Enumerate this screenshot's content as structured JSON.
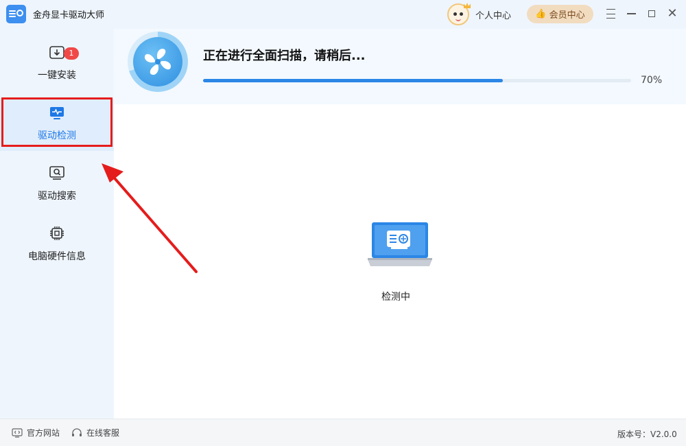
{
  "app": {
    "title": "金舟显卡驱动大师"
  },
  "header": {
    "personal_center": "个人中心",
    "vip_center": "会员中心",
    "vip_icon": "thumbs-up-icon"
  },
  "sidebar": {
    "items": [
      {
        "label": "一键安装",
        "icon": "download-icon",
        "badge": "1",
        "active": false
      },
      {
        "label": "驱动检测",
        "icon": "monitor-pulse-icon",
        "active": true
      },
      {
        "label": "驱动搜索",
        "icon": "monitor-search-icon",
        "active": false
      },
      {
        "label": "电脑硬件信息",
        "icon": "chip-icon",
        "active": false
      }
    ]
  },
  "scan": {
    "title": "正在进行全面扫描，请稍后...",
    "progress_percent": 70,
    "progress_label": "70%"
  },
  "main": {
    "status_text": "检测中"
  },
  "footer": {
    "official_site": "官方网站",
    "online_service": "在线客服",
    "version_label": "版本号：V2.0.0"
  },
  "colors": {
    "accent": "#2b86e6",
    "highlight": "#e51c1c",
    "badge": "#f04848",
    "vip_bg": "#f2dcc0"
  }
}
